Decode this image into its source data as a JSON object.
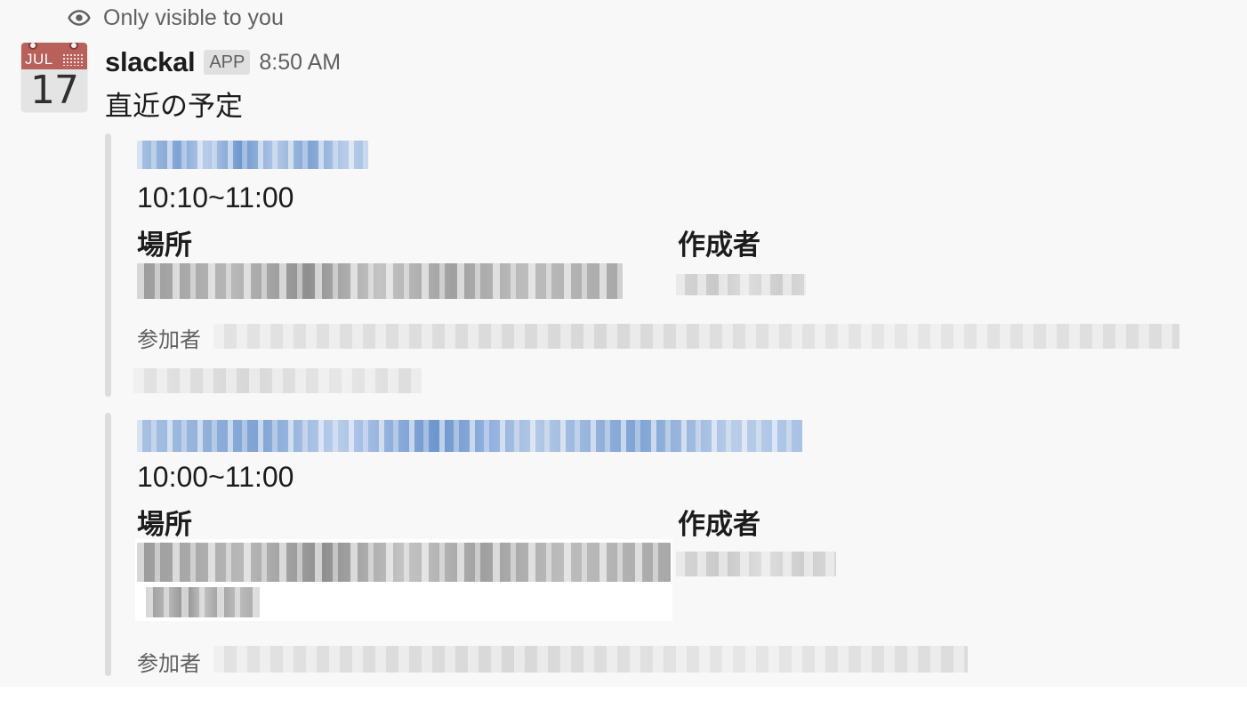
{
  "ephemeral": {
    "text": "Only visible to you",
    "icon": "eye-icon"
  },
  "avatar": {
    "month": "JUL",
    "day": "17",
    "color": "#b8605a"
  },
  "message": {
    "sender": "slackal",
    "badge": "APP",
    "timestamp": "8:50 AM",
    "text": "直近の予定"
  },
  "events": [
    {
      "time": "10:10~11:00",
      "location_label": "場所",
      "creator_label": "作成者",
      "participants_label": "参加者"
    },
    {
      "time": "10:00~11:00",
      "location_label": "場所",
      "creator_label": "作成者",
      "participants_label": "参加者"
    }
  ],
  "colors": {
    "link": "#1264a3",
    "attachment_bar": "#dddddd",
    "background": "#f8f8f8"
  }
}
